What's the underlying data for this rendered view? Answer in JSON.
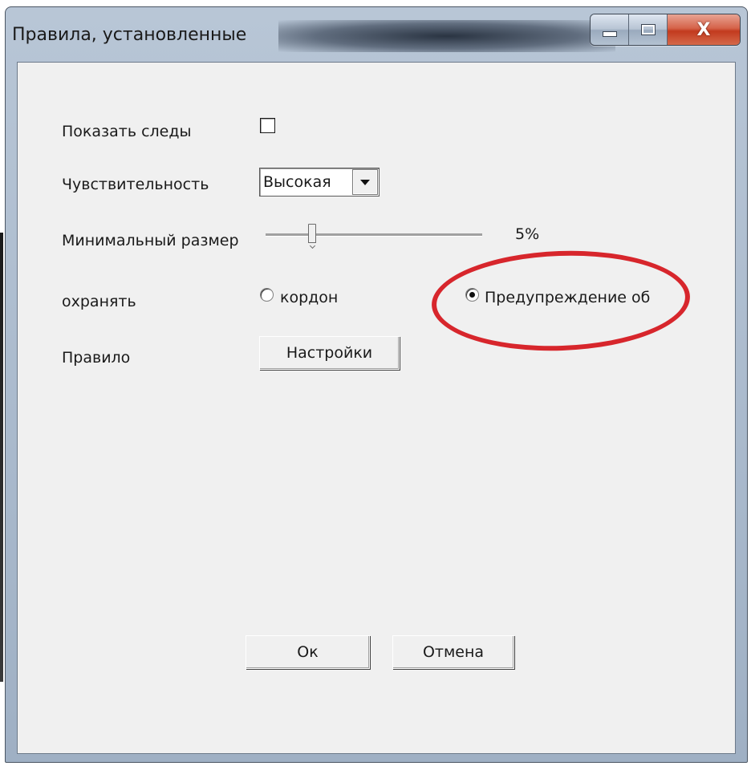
{
  "window": {
    "title": "Правила, установленные",
    "close_glyph": "X"
  },
  "form": {
    "show_traces_label": "Показать следы",
    "show_traces_checked": false,
    "sensitivity_label": "Чувствительность",
    "sensitivity_value": "Высокая",
    "min_size_label": "Минимальный размер",
    "min_size_value": "5%",
    "min_size_fraction": 0.05,
    "protect_label": "охранять",
    "radio_cordon_label": "кордон",
    "radio_cordon_checked": false,
    "radio_warning_label": "Предупреждение об",
    "radio_warning_checked": true,
    "rule_label": "Правило",
    "settings_button": "Настройки"
  },
  "footer": {
    "ok_label": "Ок",
    "cancel_label": "Отмена"
  },
  "colors": {
    "annotation": "#d7262c",
    "client_bg": "#f0f0f0",
    "close_button": "#c23a1e"
  }
}
